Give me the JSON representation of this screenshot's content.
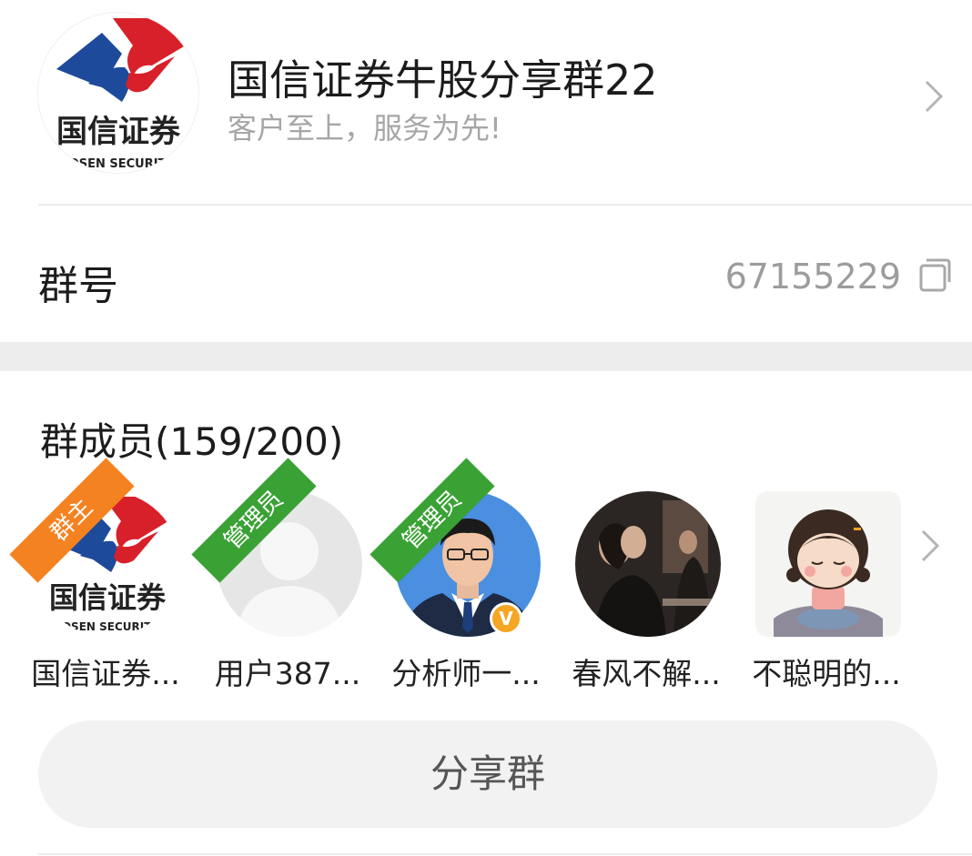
{
  "group": {
    "name": "国信证券牛股分享群22",
    "slogan": "客户至上，服务为先!",
    "logo_text": "国信证券",
    "logo_subtext": "GUOSEN SECURITIES"
  },
  "group_id": {
    "label": "群号",
    "value": "67155229"
  },
  "members": {
    "title": "群成员(159/200)",
    "list": [
      {
        "name": "国信证券...",
        "role": "群主",
        "avatar": "guosen-logo"
      },
      {
        "name": "用户387...",
        "role": "管理员",
        "avatar": "default-silhouette"
      },
      {
        "name": "分析师一...",
        "role": "管理员",
        "avatar": "man-in-suit-photo",
        "badge": "V"
      },
      {
        "name": "春风不解...",
        "role": "",
        "avatar": "dark-photo"
      },
      {
        "name": "不聪明的...",
        "role": "",
        "avatar": "cartoon-girl"
      }
    ]
  },
  "share_button": {
    "label": "分享群"
  },
  "colors": {
    "brand_red": "#d8202a",
    "brand_blue": "#1e4a9b",
    "owner_ribbon": "#f58220",
    "admin_ribbon": "#3aa135",
    "verified_badge": "#f5a623"
  },
  "icons": {
    "header_chevron": "chevron-right-icon",
    "copy": "copy-icon",
    "members_chevron": "chevron-right-icon"
  }
}
